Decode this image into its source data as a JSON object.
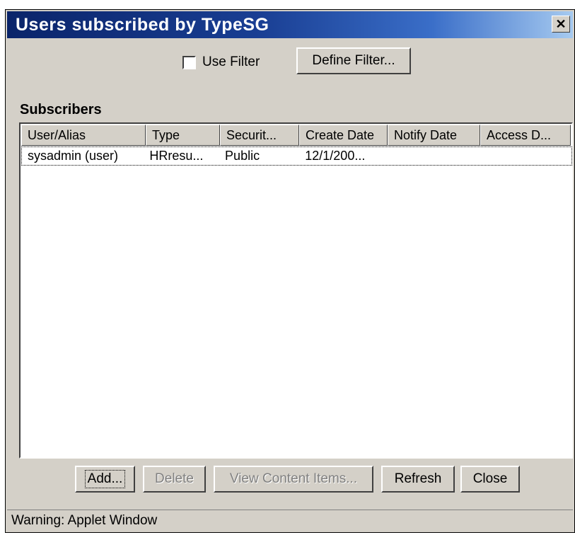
{
  "window": {
    "title": "Users subscribed by TypeSG",
    "close_glyph": "✕"
  },
  "filter": {
    "use_filter_label": "Use Filter",
    "use_filter_checked": false,
    "define_filter_label": "Define Filter..."
  },
  "subscribers": {
    "label": "Subscribers",
    "columns": [
      "User/Alias",
      "Type",
      "Securit...",
      "Create Date",
      "Notify Date",
      "Access D..."
    ],
    "rows": [
      [
        "sysadmin (user)",
        "HRresu...",
        "Public",
        "12/1/200...",
        "",
        ""
      ]
    ]
  },
  "buttons": {
    "add": "Add...",
    "delete": "Delete",
    "view_content_items": "View Content Items...",
    "refresh": "Refresh",
    "close": "Close"
  },
  "status": {
    "text": "Warning: Applet Window"
  },
  "colors": {
    "title_start": "#0a246a",
    "title_end": "#a6caf0",
    "face": "#d4d0c8"
  }
}
